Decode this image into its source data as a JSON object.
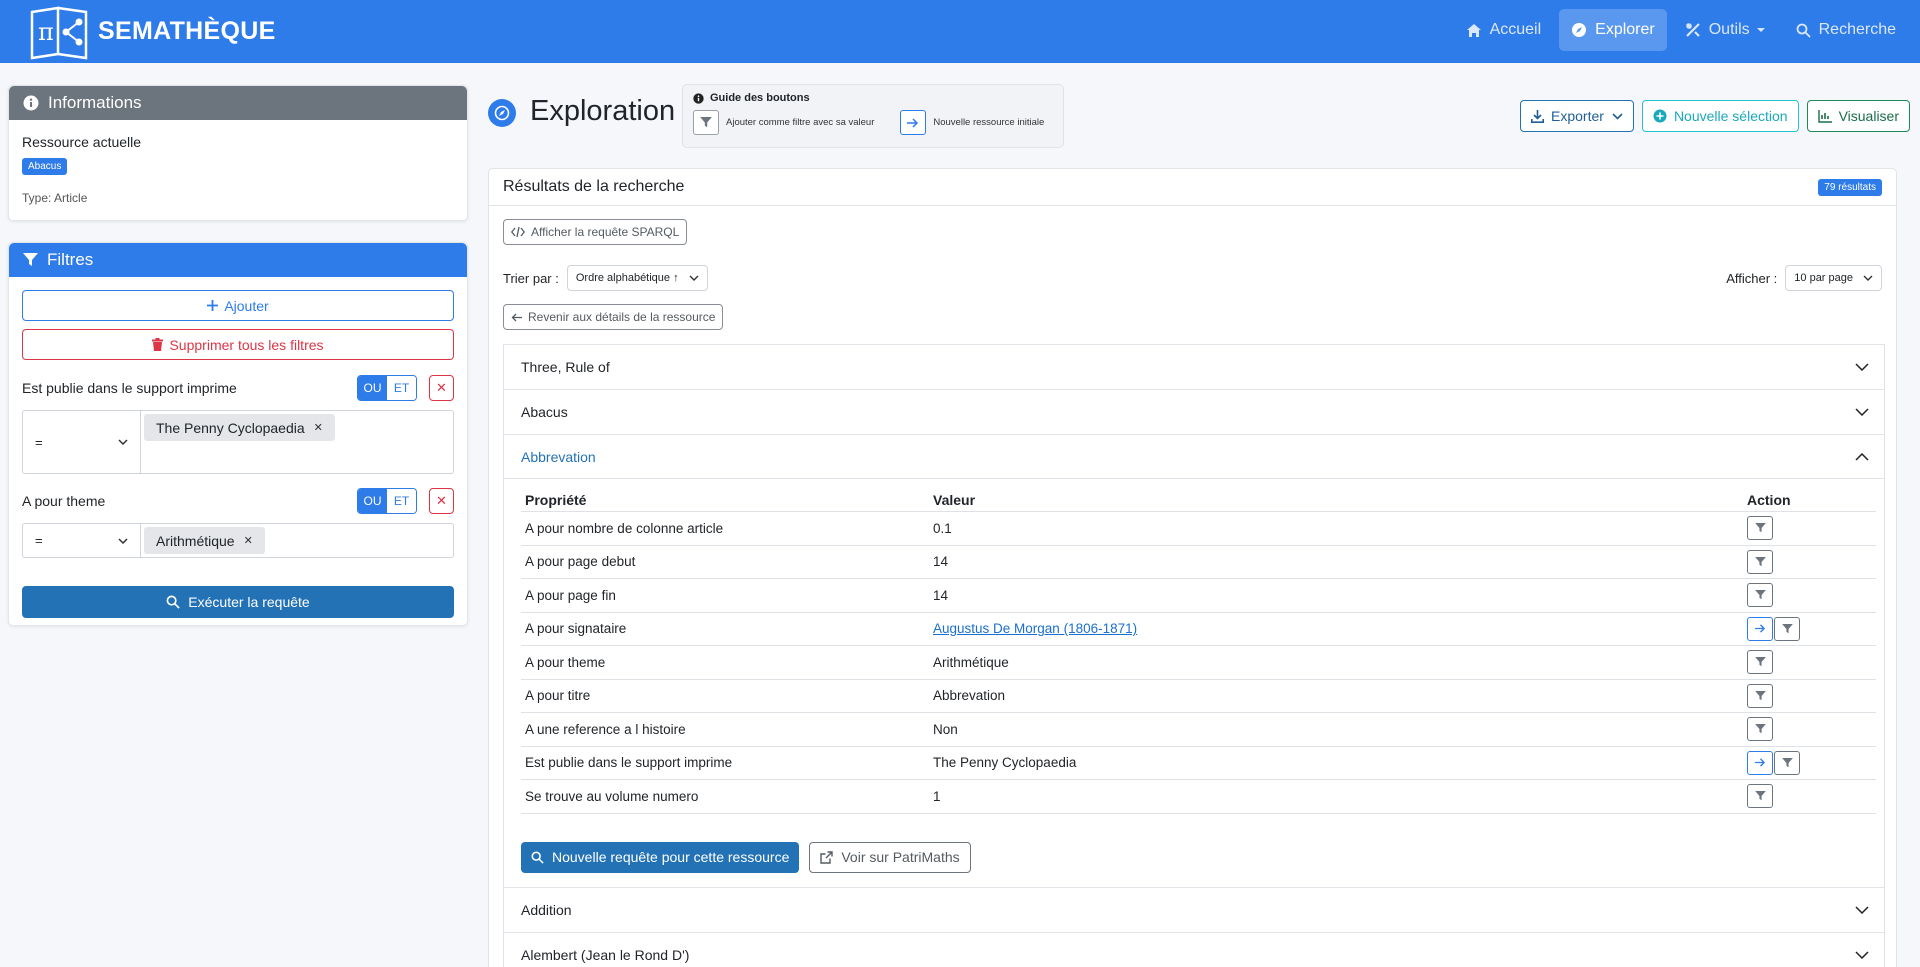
{
  "app": {
    "brand": "SEMATHÈQUE"
  },
  "nav": {
    "home": "Accueil",
    "explore": "Explorer",
    "tools": "Outils",
    "search": "Recherche"
  },
  "info_panel": {
    "title": "Informations",
    "current_label": "Ressource actuelle",
    "current_badge": "Abacus",
    "type_line": "Type: Article"
  },
  "filters_panel": {
    "title": "Filtres",
    "add_label": "Ajouter",
    "delete_all_label": "Supprimer tous les filtres",
    "or_label": "OU",
    "and_label": "ET",
    "filters": [
      {
        "property": "Est publie dans le support imprime",
        "operator": "=",
        "value": "The Penny Cyclopaedia",
        "mode": "OU"
      },
      {
        "property": "A pour theme",
        "operator": "=",
        "value": "Arithmétique",
        "mode": "OU"
      }
    ],
    "execute_label": "Exécuter la requête"
  },
  "main": {
    "title": "Exploration",
    "guide": {
      "title": "Guide des boutons",
      "filter_hint": "Ajouter comme filtre avec sa valeur",
      "new_resource_hint": "Nouvelle ressource initiale"
    },
    "actions": {
      "export": "Exporter",
      "new_selection": "Nouvelle sélection",
      "visualize": "Visualiser"
    }
  },
  "results": {
    "title": "Résultats de la recherche",
    "count": "79 résultats",
    "sparql_label": "Afficher la requête SPARQL",
    "sort_label": "Trier par :",
    "sort_value": "Ordre alphabétique ↑",
    "show_label": "Afficher :",
    "per_page_value": "10 par page",
    "back_label": "Revenir aux détails de la ressource",
    "items": [
      {
        "label": "Three, Rule of",
        "open": false
      },
      {
        "label": "Abacus",
        "open": false
      },
      {
        "label": "Abbrevation",
        "open": true
      },
      {
        "label": "Addition",
        "open": false
      },
      {
        "label": "Alembert (Jean le Rond D')",
        "open": false
      }
    ],
    "table": {
      "headers": {
        "property": "Propriété",
        "value": "Valeur",
        "action": "Action"
      },
      "rows": [
        {
          "property": "A pour nombre de colonne article",
          "value": "0.1",
          "link": false,
          "navigable": false
        },
        {
          "property": "A pour page debut",
          "value": "14",
          "link": false,
          "navigable": false
        },
        {
          "property": "A pour page fin",
          "value": "14",
          "link": false,
          "navigable": false
        },
        {
          "property": "A pour signataire",
          "value": "Augustus De Morgan (1806-1871)",
          "link": true,
          "navigable": true
        },
        {
          "property": "A pour theme",
          "value": "Arithmétique",
          "link": false,
          "navigable": false
        },
        {
          "property": "A pour titre",
          "value": "Abbrevation",
          "link": false,
          "navigable": false
        },
        {
          "property": "A une reference a l histoire",
          "value": "Non",
          "link": false,
          "navigable": false
        },
        {
          "property": "Est publie dans le support imprime",
          "value": "The Penny Cyclopaedia",
          "link": false,
          "navigable": true
        },
        {
          "property": "Se trouve au volume numero",
          "value": "1",
          "link": false,
          "navigable": false
        }
      ]
    },
    "new_query_label": "Nouvelle requête pour cette ressource",
    "view_patrimaths_label": "Voir sur PatriMaths"
  }
}
